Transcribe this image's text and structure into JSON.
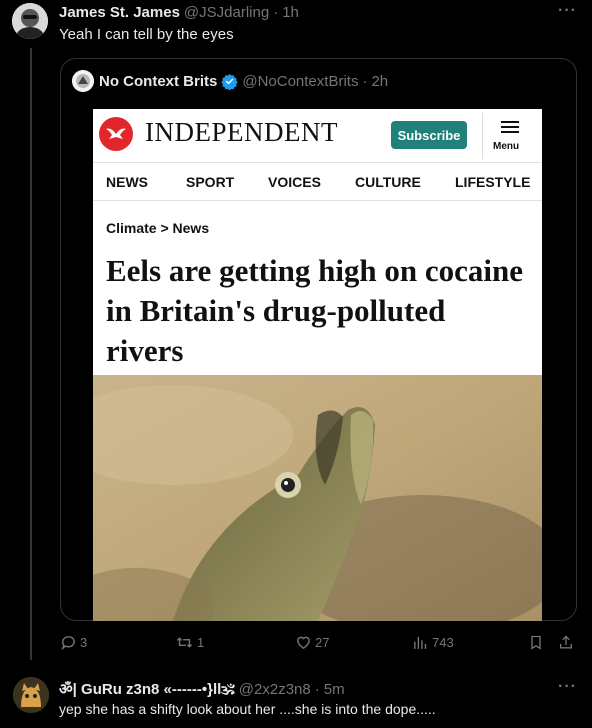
{
  "main_tweet": {
    "display_name": "James St. James",
    "handle": "@JSJdarling",
    "separator": "·",
    "time": "1h",
    "text": "Yeah I can tell by the eyes"
  },
  "quoted_tweet": {
    "display_name": "No Context Brits",
    "handle": "@NoContextBrits",
    "separator": "·",
    "time": "2h",
    "verified": true
  },
  "article": {
    "brand": "INDEPENDENT",
    "subscribe_label": "Subscribe",
    "menu_label": "Menu",
    "nav": [
      "NEWS",
      "SPORT",
      "VOICES",
      "CULTURE",
      "LIFESTYLE"
    ],
    "breadcrumb": "Climate > News",
    "headline": "Eels are getting high on cocaine in Britain's drug-polluted rivers",
    "brand_color": "#e3262c",
    "subscribe_color": "#20807a"
  },
  "actions": {
    "replies": "3",
    "reposts": "1",
    "likes": "27",
    "views": "743"
  },
  "reply": {
    "display_name": "ॐ| GuRu z3n8 «------•}ll🕉",
    "handle": "@2x2z3n8",
    "separator": "·",
    "time": "5m",
    "text": "yep she has a shifty look about her ....she is into the dope....."
  },
  "icons": {
    "more": "more-icon",
    "verified": "verified-badge-icon",
    "reply": "reply-icon",
    "repost": "repost-icon",
    "like": "like-icon",
    "views": "views-icon",
    "bookmark": "bookmark-icon",
    "share": "share-icon"
  },
  "colors": {
    "background": "#000000",
    "text": "#e7e9ea",
    "muted": "#71767b",
    "verified": "#1d9bf0",
    "border": "#2f3336"
  }
}
